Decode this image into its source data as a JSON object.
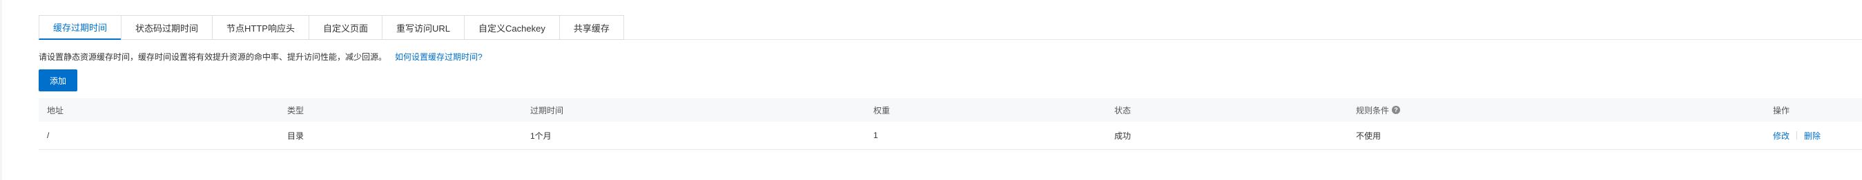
{
  "tabs": [
    {
      "label": "缓存过期时间",
      "active": true
    },
    {
      "label": "状态码过期时间",
      "active": false
    },
    {
      "label": "节点HTTP响应头",
      "active": false
    },
    {
      "label": "自定义页面",
      "active": false
    },
    {
      "label": "重写访问URL",
      "active": false
    },
    {
      "label": "自定义Cachekey",
      "active": false
    },
    {
      "label": "共享缓存",
      "active": false
    }
  ],
  "description": {
    "text": "请设置静态资源缓存时间，缓存时间设置将有效提升资源的命中率、提升访问性能，减少回源。",
    "link": "如何设置缓存过期时间?"
  },
  "add_button": "添加",
  "table": {
    "headers": [
      "地址",
      "类型",
      "过期时间",
      "权重",
      "状态",
      "规则条件",
      "操作"
    ],
    "rows": [
      {
        "address": "/",
        "type": "目录",
        "expire": "1个月",
        "weight": "1",
        "status": "成功",
        "condition": "不使用",
        "actions": [
          "修改",
          "删除"
        ]
      }
    ]
  },
  "icons": {
    "rule_condition_help": "question-circle-icon"
  },
  "colors": {
    "accent": "#0070cc",
    "header_bg": "#f7f8fa"
  }
}
